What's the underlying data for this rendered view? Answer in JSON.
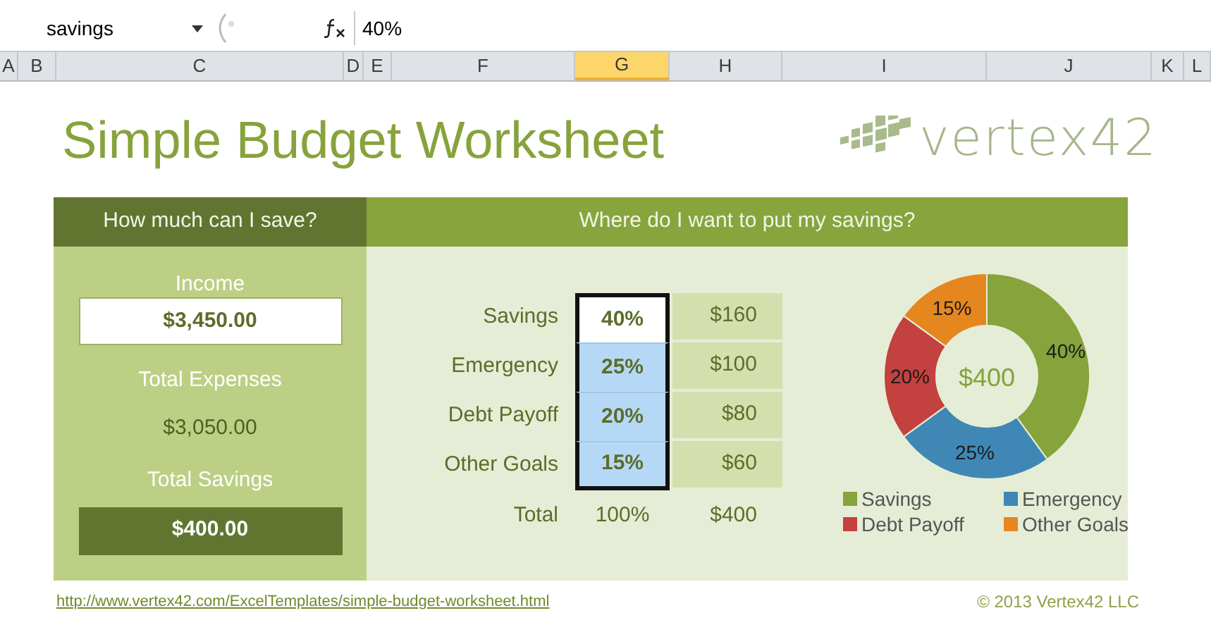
{
  "formula_bar": {
    "name_box": "savings",
    "value": "40%"
  },
  "column_headers": [
    {
      "label": "A",
      "selected": false
    },
    {
      "label": "B",
      "selected": false
    },
    {
      "label": "C",
      "selected": false
    },
    {
      "label": "D",
      "selected": false
    },
    {
      "label": "E",
      "selected": false
    },
    {
      "label": "F",
      "selected": false
    },
    {
      "label": "G",
      "selected": true
    },
    {
      "label": "H",
      "selected": false
    },
    {
      "label": "I",
      "selected": false
    },
    {
      "label": "J",
      "selected": false
    },
    {
      "label": "K",
      "selected": false
    },
    {
      "label": "L",
      "selected": false
    }
  ],
  "title": "Simple Budget Worksheet",
  "logo": {
    "text": "vertex42"
  },
  "left_panel": {
    "header": "How much can I save?",
    "income_label": "Income",
    "income": "$3,450.00",
    "expenses_label": "Total Expenses",
    "expenses": "$3,050.00",
    "savings_label": "Total Savings",
    "savings": "$400.00"
  },
  "right_panel": {
    "header": "Where do I want to put my savings?",
    "rows": [
      {
        "label": "Savings",
        "percent": "40%",
        "amount": "$160",
        "selected": true,
        "active": true
      },
      {
        "label": "Emergency",
        "percent": "25%",
        "amount": "$100",
        "selected": true,
        "active": false
      },
      {
        "label": "Debt Payoff",
        "percent": "20%",
        "amount": "$80",
        "selected": true,
        "active": false
      },
      {
        "label": "Other Goals",
        "percent": "15%",
        "amount": "$60",
        "selected": true,
        "active": false
      }
    ],
    "total": {
      "label": "Total",
      "percent": "100%",
      "amount": "$400"
    },
    "chart": {
      "center_label": "$400",
      "chart_data": {
        "type": "donut",
        "categories": [
          "Savings",
          "Emergency",
          "Debt Payoff",
          "Other Goals"
        ],
        "values": [
          40,
          25,
          20,
          15
        ],
        "legend": "bottom",
        "colors": [
          "#86a33c",
          "#3f88b5",
          "#c3413e",
          "#e6861f"
        ],
        "value_labels": [
          "40%",
          "25%",
          "20%",
          "15%"
        ]
      }
    }
  },
  "footer": {
    "link": "http://www.vertex42.com/ExcelTemplates/simple-budget-worksheet.html",
    "copyright": "© 2013 Vertex42 LLC"
  }
}
